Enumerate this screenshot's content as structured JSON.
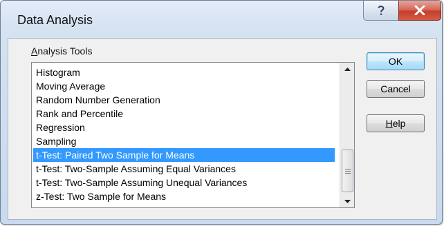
{
  "window": {
    "title": "Data Analysis",
    "help_glyph": "?",
    "close_glyph": "X"
  },
  "analysis_tools": {
    "label_accel": "A",
    "label_rest": "nalysis Tools",
    "items": [
      "Histogram",
      "Moving Average",
      "Random Number Generation",
      "Rank and Percentile",
      "Regression",
      "Sampling",
      "t-Test: Paired Two Sample for Means",
      "t-Test: Two-Sample Assuming Equal Variances",
      "t-Test: Two-Sample Assuming Unequal Variances",
      "z-Test: Two Sample for Means"
    ],
    "selected_index": 6
  },
  "buttons": {
    "ok": "OK",
    "cancel": "Cancel",
    "help_accel": "H",
    "help_rest": "elp"
  },
  "colors": {
    "selection": "#3399ff",
    "close_button": "#c5402c"
  }
}
